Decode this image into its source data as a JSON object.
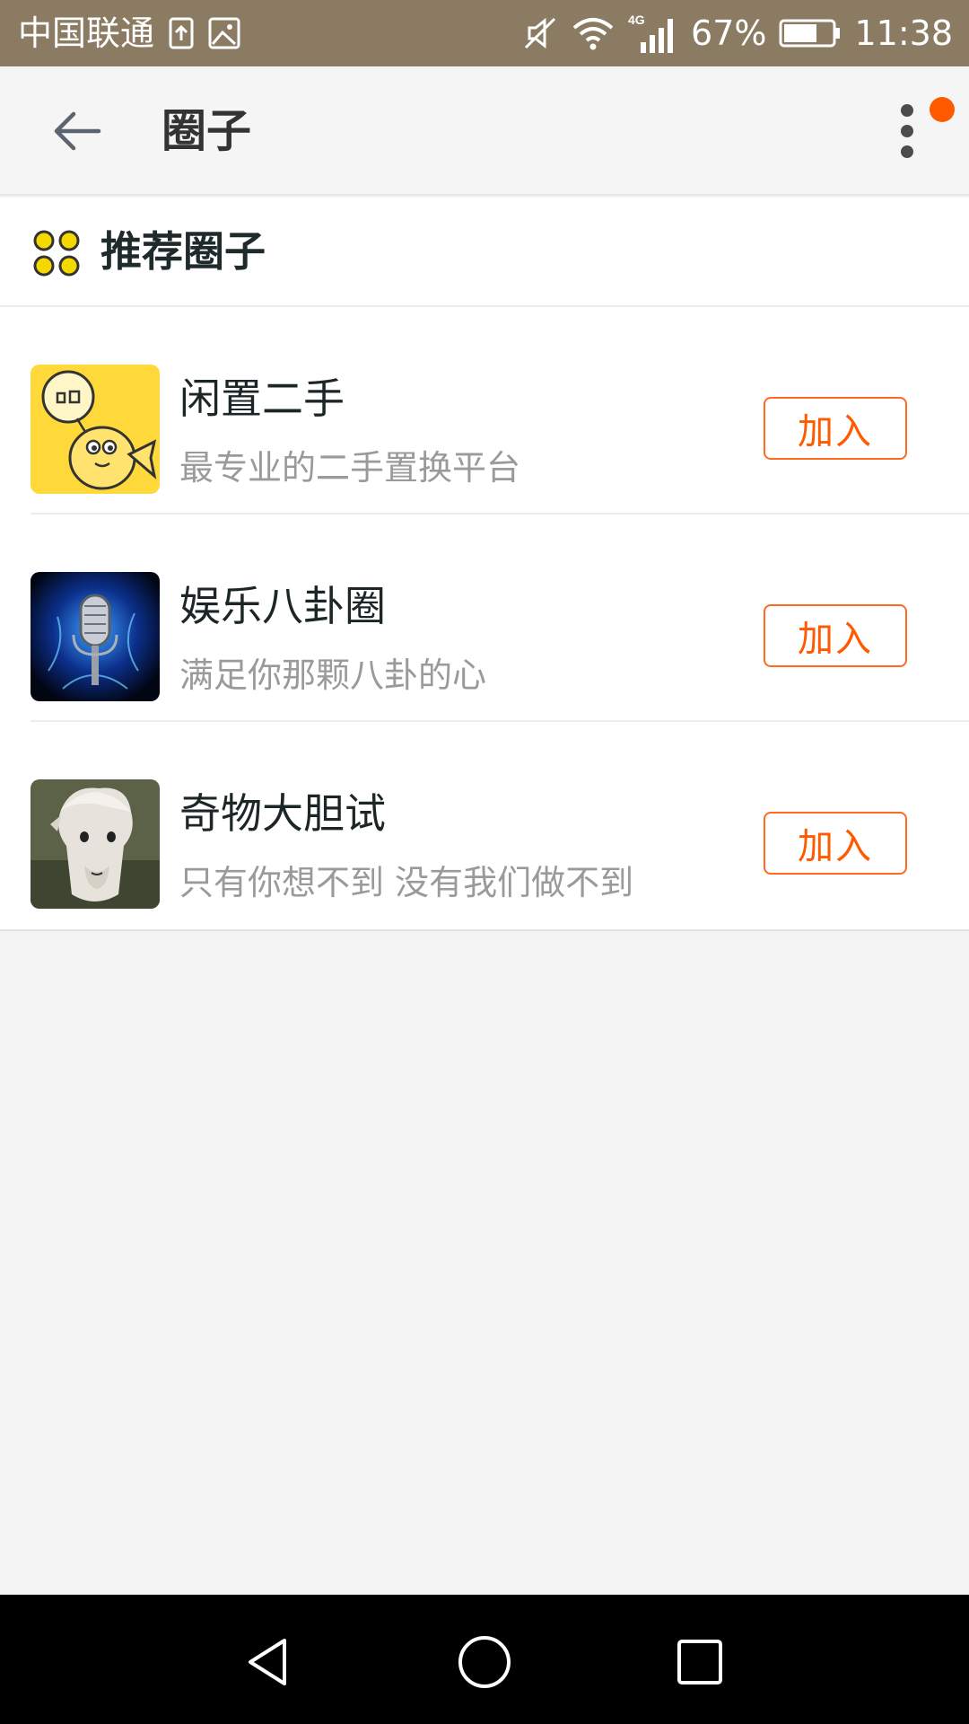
{
  "status_bar": {
    "carrier": "中国联通",
    "battery_percent": "67%",
    "time": "11:38",
    "network": "4G",
    "icons": [
      "upload-notification-icon",
      "image-notification-icon",
      "mute-icon",
      "wifi-icon",
      "signal-icon",
      "battery-icon"
    ]
  },
  "app_bar": {
    "title": "圈子",
    "icons": [
      "back-arrow-icon",
      "more-vertical-icon"
    ],
    "has_notification": true
  },
  "section": {
    "title": "推荐圈子",
    "icon": "four-circles-icon",
    "icon_color": "#f5d800"
  },
  "circles": [
    {
      "name": "闲置二手",
      "description": "最专业的二手置换平台",
      "join_label": "加入",
      "thumb": "fish-balloon-logo"
    },
    {
      "name": "娱乐八卦圈",
      "description": "满足你那颗八卦的心",
      "join_label": "加入",
      "thumb": "microphone-image"
    },
    {
      "name": "奇物大胆试",
      "description": "只有你想不到 没有我们做不到",
      "join_label": "加入",
      "thumb": "alpaca-image"
    }
  ],
  "nav_bar": {
    "icons": [
      "nav-back-icon",
      "nav-home-icon",
      "nav-recents-icon"
    ]
  },
  "colors": {
    "status_bar": "#8a7b62",
    "accent": "#ff5a00",
    "background": "#f3f3f3"
  }
}
